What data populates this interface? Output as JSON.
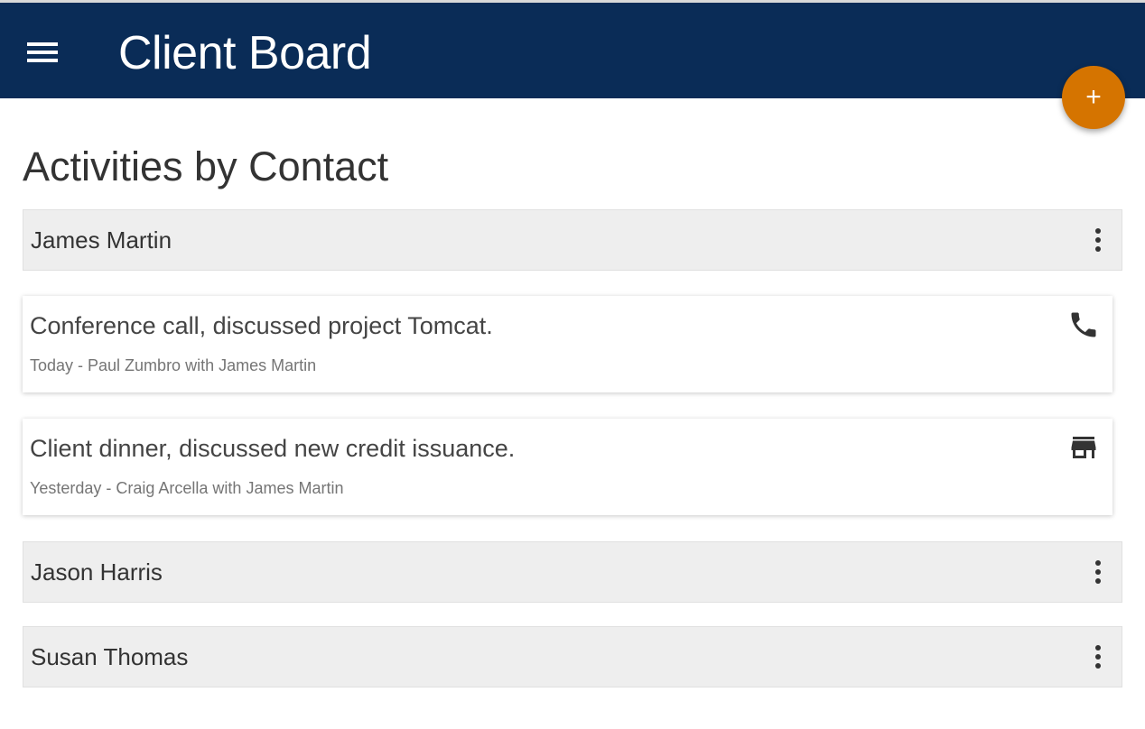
{
  "app_bar": {
    "title": "Client Board",
    "menu_icon": "hamburger-menu-icon",
    "background": "#0a2c57"
  },
  "fab": {
    "label": "+",
    "icon": "add-icon",
    "color": "#d57400"
  },
  "page": {
    "heading": "Activities by Contact"
  },
  "contacts": [
    {
      "name": "James Martin",
      "menu_icon": "more-vert-icon",
      "activities": [
        {
          "title": "Conference call, discussed project Tomcat.",
          "meta": "Today - Paul Zumbro with James Martin",
          "icon": "phone-icon"
        },
        {
          "title": "Client dinner, discussed new credit issuance.",
          "meta": "Yesterday - Craig Arcella with James Martin",
          "icon": "store-icon"
        }
      ]
    },
    {
      "name": "Jason Harris",
      "menu_icon": "more-vert-icon",
      "activities": []
    },
    {
      "name": "Susan Thomas",
      "menu_icon": "more-vert-icon",
      "activities": []
    }
  ]
}
